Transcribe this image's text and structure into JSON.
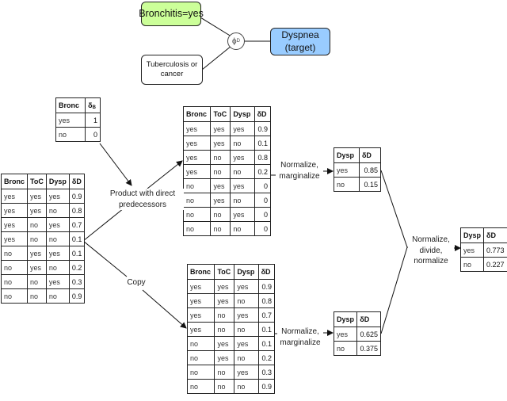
{
  "graph": {
    "evidence_node": "Bronchitis=yes",
    "parent_node": "Tuberculosis or cancer",
    "target_node_line1": "Dyspnea",
    "target_node_line2": "(target)",
    "factor_symbol": "ϕ",
    "factor_subscript": "D",
    "colors": {
      "evidence": "#ccff99",
      "target": "#99ccff"
    }
  },
  "evidence_table": {
    "headers": [
      "Bronc",
      "δ",
      "B"
    ],
    "rows": [
      [
        "yes",
        "1"
      ],
      [
        "no",
        "0"
      ]
    ]
  },
  "cpt_table": {
    "headers": [
      "Bronc",
      "ToC",
      "Dysp",
      "δD"
    ],
    "rows": [
      [
        "yes",
        "yes",
        "yes",
        "0.9"
      ],
      [
        "yes",
        "yes",
        "no",
        "0.8"
      ],
      [
        "yes",
        "no",
        "yes",
        "0.7"
      ],
      [
        "yes",
        "no",
        "no",
        "0.1"
      ],
      [
        "no",
        "yes",
        "yes",
        "0.1"
      ],
      [
        "no",
        "yes",
        "no",
        "0.2"
      ],
      [
        "no",
        "no",
        "yes",
        "0.3"
      ],
      [
        "no",
        "no",
        "no",
        "0.9"
      ]
    ]
  },
  "product_table": {
    "headers": [
      "Bronc",
      "ToC",
      "Dysp",
      "δD"
    ],
    "rows": [
      [
        "yes",
        "yes",
        "yes",
        "0.9"
      ],
      [
        "yes",
        "yes",
        "no",
        "0.1"
      ],
      [
        "yes",
        "no",
        "yes",
        "0.8"
      ],
      [
        "yes",
        "no",
        "no",
        "0.2"
      ],
      [
        "no",
        "yes",
        "yes",
        "0"
      ],
      [
        "no",
        "yes",
        "no",
        "0"
      ],
      [
        "no",
        "no",
        "yes",
        "0"
      ],
      [
        "no",
        "no",
        "no",
        "0"
      ]
    ]
  },
  "copy_table": {
    "headers": [
      "Bronc",
      "ToC",
      "Dysp",
      "δD"
    ],
    "rows": [
      [
        "yes",
        "yes",
        "yes",
        "0.9"
      ],
      [
        "yes",
        "yes",
        "no",
        "0.8"
      ],
      [
        "yes",
        "no",
        "yes",
        "0.7"
      ],
      [
        "yes",
        "no",
        "no",
        "0.1"
      ],
      [
        "no",
        "yes",
        "yes",
        "0.1"
      ],
      [
        "no",
        "yes",
        "no",
        "0.2"
      ],
      [
        "no",
        "no",
        "yes",
        "0.3"
      ],
      [
        "no",
        "no",
        "no",
        "0.9"
      ]
    ]
  },
  "norm_table_top": {
    "headers": [
      "Dysp",
      "δD"
    ],
    "rows": [
      [
        "yes",
        "0.85"
      ],
      [
        "no",
        "0.15"
      ]
    ]
  },
  "norm_table_bottom": {
    "headers": [
      "Dysp",
      "δD"
    ],
    "rows": [
      [
        "yes",
        "0.625"
      ],
      [
        "no",
        "0.375"
      ]
    ]
  },
  "final_table": {
    "headers": [
      "Dysp",
      "δD"
    ],
    "rows": [
      [
        "yes",
        "0.773"
      ],
      [
        "no",
        "0.227"
      ]
    ]
  },
  "labels": {
    "product": [
      "Product with direct",
      "predecessors"
    ],
    "copy": "Copy",
    "normalize_top": [
      "Normalize,",
      "marginalize"
    ],
    "normalize_bottom": [
      "Normalize,",
      "marginalize"
    ],
    "final": [
      "Normalize,",
      "divide,",
      "normalize"
    ]
  }
}
